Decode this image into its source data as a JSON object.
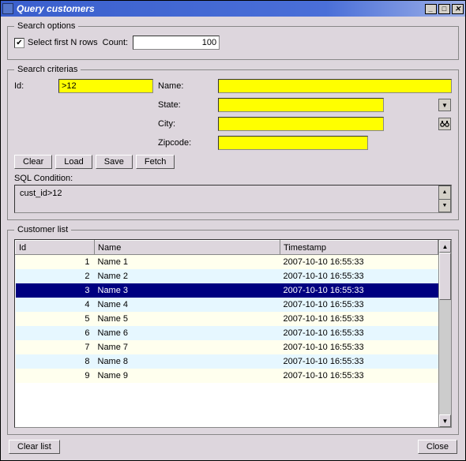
{
  "window": {
    "title": "Query customers"
  },
  "search_options": {
    "legend": "Search options",
    "select_first_n_label": "Select first N rows",
    "count_label": "Count:",
    "count_value": "100"
  },
  "criteria": {
    "legend": "Search criterias",
    "id_label": "Id:",
    "id_value": ">12",
    "name_label": "Name:",
    "name_value": "",
    "state_label": "State:",
    "state_value": "",
    "city_label": "City:",
    "city_value": "",
    "zipcode_label": "Zipcode:",
    "zipcode_value": "",
    "clear_label": "Clear",
    "load_label": "Load",
    "save_label": "Save",
    "fetch_label": "Fetch",
    "sql_label": "SQL Condition:",
    "sql_value": "cust_id>12"
  },
  "customer_list": {
    "legend": "Customer list",
    "headers": {
      "id": "Id",
      "name": "Name",
      "timestamp": "Timestamp"
    },
    "rows": [
      {
        "id": "1",
        "name": "Name 1",
        "timestamp": "2007-10-10 16:55:33",
        "selected": false
      },
      {
        "id": "2",
        "name": "Name 2",
        "timestamp": "2007-10-10 16:55:33",
        "selected": false
      },
      {
        "id": "3",
        "name": "Name 3",
        "timestamp": "2007-10-10 16:55:33",
        "selected": true
      },
      {
        "id": "4",
        "name": "Name 4",
        "timestamp": "2007-10-10 16:55:33",
        "selected": false
      },
      {
        "id": "5",
        "name": "Name 5",
        "timestamp": "2007-10-10 16:55:33",
        "selected": false
      },
      {
        "id": "6",
        "name": "Name 6",
        "timestamp": "2007-10-10 16:55:33",
        "selected": false
      },
      {
        "id": "7",
        "name": "Name 7",
        "timestamp": "2007-10-10 16:55:33",
        "selected": false
      },
      {
        "id": "8",
        "name": "Name 8",
        "timestamp": "2007-10-10 16:55:33",
        "selected": false
      },
      {
        "id": "9",
        "name": "Name 9",
        "timestamp": "2007-10-10 16:55:33",
        "selected": false
      }
    ]
  },
  "footer": {
    "clear_list_label": "Clear list",
    "close_label": "Close"
  }
}
